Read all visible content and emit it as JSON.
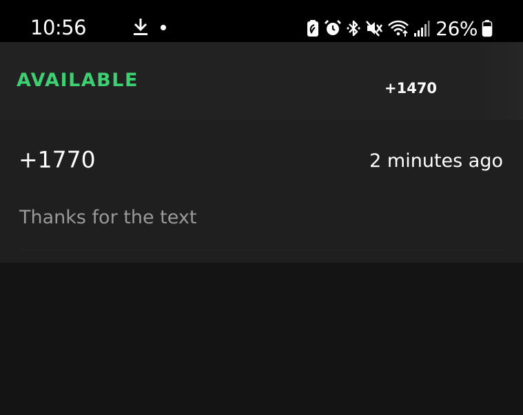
{
  "status_bar": {
    "time": "10:56",
    "left_icons": [
      "download-icon",
      "notification-dot-icon"
    ],
    "right_icons": [
      "battery-saver-icon",
      "alarm-icon",
      "bluetooth-icon",
      "mute-icon",
      "wifi-icon",
      "signal-icon",
      "battery-icon"
    ],
    "battery_percent": "26%"
  },
  "header": {
    "status_label": "AVAILABLE",
    "phone_number": "+1470",
    "status_color": "#3ecf72"
  },
  "messages": [
    {
      "sender": "+1770",
      "time": "2 minutes ago",
      "preview": "Thanks for the text"
    }
  ]
}
